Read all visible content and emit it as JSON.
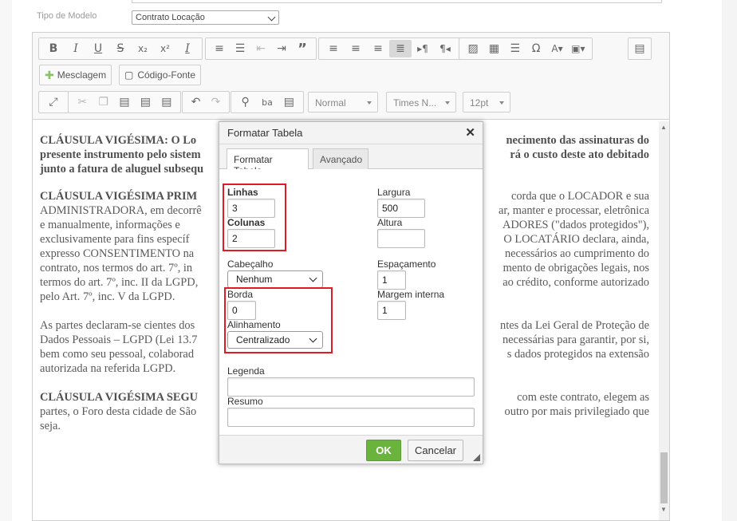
{
  "form": {
    "model_label": "Tipo de Modelo",
    "model_value": "Contrato Locação"
  },
  "toolbar": {
    "row1": [
      {
        "name": "bold-button",
        "glyph": "B"
      },
      {
        "name": "italic-button",
        "glyph": "I"
      },
      {
        "name": "underline-button",
        "glyph": "U"
      },
      {
        "name": "strikethrough-button",
        "glyph": "S"
      },
      {
        "name": "subscript-button",
        "glyph": "x₂"
      },
      {
        "name": "superscript-button",
        "glyph": "x²"
      },
      {
        "name": "remove-format-button",
        "glyph": "Ix"
      }
    ],
    "merge_label": "Mesclagem",
    "source_label": "Código-Fonte",
    "format_combo": "Normal",
    "font_combo": "Times N...",
    "size_combo": "12pt"
  },
  "content": {
    "p1_bold": "CLÁUSULA VIGÉSIMA: O Lo",
    "p1_rest": "cimento das assinaturas do presente instrumento pelo sistema ... rá o custo deste ato debitado junto a fatura de aluguel subsequ",
    "p1_line1_right": "necimento das assinaturas do",
    "p1_line2_left": "presente instrumento pelo sistem",
    "p1_line2_right": "rá o custo deste ato debitado",
    "p1_line3": "junto a fatura de aluguel subsequ",
    "p2_bold": "CLÁUSULA VIGÉSIMA PRIM",
    "p2_l1_right": "corda que o LOCADOR e sua",
    "p2_l2_left": "ADMINISTRADORA, em decorrê",
    "p2_l2_right": "ar, manter e processar, eletrônica",
    "p2_l3_left": "e manualmente, informações e",
    "p2_l3_right": "ADORES (\"dados protegidos\"),",
    "p2_l4_left": "exclusivamente para fins específ",
    "p2_l4_right": "O LOCATÁRIO declara, ainda,",
    "p2_l5_left": "expresso CONSENTIMENTO na",
    "p2_l5_right": "necessários ao cumprimento do",
    "p2_l6_left": "contrato, nos termos do art. 7º, in",
    "p2_l6_right": "mento de obrigações legais, nos",
    "p2_l7_left": "termos do art. 7º, inc. II da LGPD,",
    "p2_l7_right": "ao crédito, conforme autorizado",
    "p2_l8": "pelo Art. 7º, inc. V da LGPD.",
    "p3_l1_left": "As partes declaram-se cientes dos",
    "p3_l1_right": "ntes da Lei Geral de Proteção de",
    "p3_l2_left": "Dados Pessoais – LGPD (Lei 13.7",
    "p3_l2_right": "necessárias para garantir, por si,",
    "p3_l3_left": "bem como seu pessoal, colaborad",
    "p3_l3_right": "s dados protegidos na extensão",
    "p3_l4": "autorizada na referida LGPD.",
    "p4_bold": "CLÁUSULA VIGÉSIMA SEGU",
    "p4_l1_right": "com este contrato, elegem as",
    "p4_l2_left": "partes, o Foro desta cidade de São",
    "p4_l2_right": "outro por mais privilegiado que",
    "p4_l3": "seja."
  },
  "dialog": {
    "title": "Formatar Tabela",
    "tabs": [
      "Formatar Tabela",
      "Avançado"
    ],
    "rows_label": "Linhas",
    "rows_value": "3",
    "cols_label": "Colunas",
    "cols_value": "2",
    "width_label": "Largura",
    "width_value": "500",
    "height_label": "Altura",
    "height_value": "",
    "header_label": "Cabeçalho",
    "header_value": "Nenhum",
    "spacing_label": "Espaçamento",
    "spacing_value": "1",
    "border_label": "Borda",
    "border_value": "0",
    "padding_label": "Margem interna",
    "padding_value": "1",
    "align_label": "Alinhamento",
    "align_value": "Centralizado",
    "caption_label": "Legenda",
    "caption_value": "",
    "summary_label": "Resumo",
    "summary_value": "",
    "ok_label": "OK",
    "cancel_label": "Cancelar"
  },
  "colors": {
    "ok_green": "#6ab43e",
    "highlight_red": "#e01b24"
  }
}
